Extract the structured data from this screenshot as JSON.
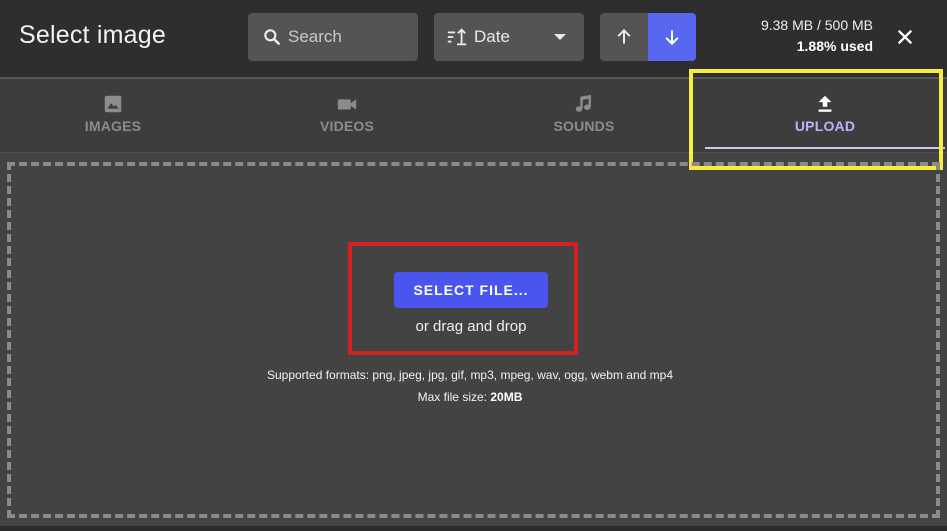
{
  "header": {
    "title": "Select image",
    "search_placeholder": "Search",
    "sort": {
      "label": "Date",
      "icon": "sort-icon"
    },
    "order_up_icon": "arrow-up-icon",
    "order_down_icon": "arrow-down-icon",
    "storage": {
      "usage": "9.38 MB / 500 MB",
      "percent": "1.88% used"
    },
    "close_icon": "close-icon"
  },
  "tabs": [
    {
      "label": "IMAGES",
      "icon": "image-icon",
      "active": false
    },
    {
      "label": "VIDEOS",
      "icon": "video-camera-icon",
      "active": false
    },
    {
      "label": "SOUNDS",
      "icon": "music-note-icon",
      "active": false
    },
    {
      "label": "UPLOAD",
      "icon": "upload-icon",
      "active": true
    }
  ],
  "upload": {
    "button_label": "SELECT FILE...",
    "drag_text": "or drag and drop",
    "formats": "Supported formats: png, jpeg, jpg, gif, mp3, mpeg, wav, ogg, webm and mp4",
    "max_label": "Max file size:",
    "max_value": "20MB"
  },
  "colors": {
    "accent": "#4a55ef",
    "sort_active": "#5867f0",
    "tab_active": "#b9b6f7",
    "highlight_yellow": "#f7ec3f",
    "highlight_red": "#d32121"
  }
}
